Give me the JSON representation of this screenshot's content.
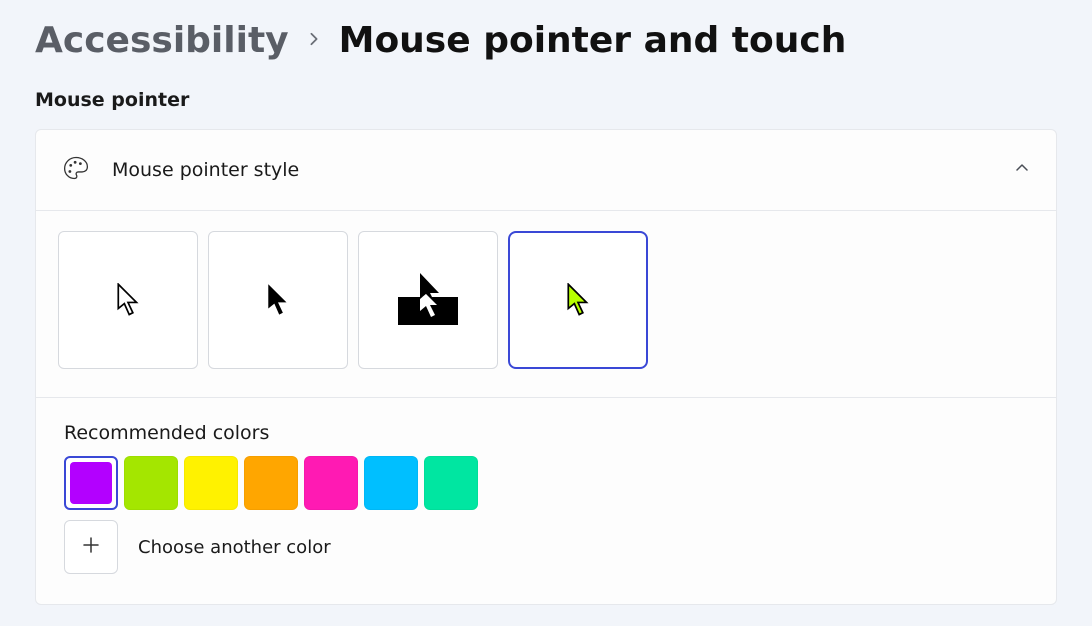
{
  "breadcrumb": {
    "root": "Accessibility",
    "current": "Mouse pointer and touch"
  },
  "section_title": "Mouse pointer",
  "card": {
    "title": "Mouse pointer style"
  },
  "pointer_styles": [
    {
      "id": "white",
      "selected": false
    },
    {
      "id": "black",
      "selected": false
    },
    {
      "id": "inverted",
      "selected": false
    },
    {
      "id": "custom",
      "selected": true
    }
  ],
  "recommended_colors": {
    "label": "Recommended colors",
    "colors": [
      {
        "value": "#b300ff",
        "selected": true
      },
      {
        "value": "#a4e600",
        "selected": false
      },
      {
        "value": "#fff200",
        "selected": false
      },
      {
        "value": "#ffa600",
        "selected": false
      },
      {
        "value": "#ff1ab3",
        "selected": false
      },
      {
        "value": "#00bfff",
        "selected": false
      },
      {
        "value": "#00e6a1",
        "selected": false
      }
    ]
  },
  "choose_another": "Choose another color"
}
